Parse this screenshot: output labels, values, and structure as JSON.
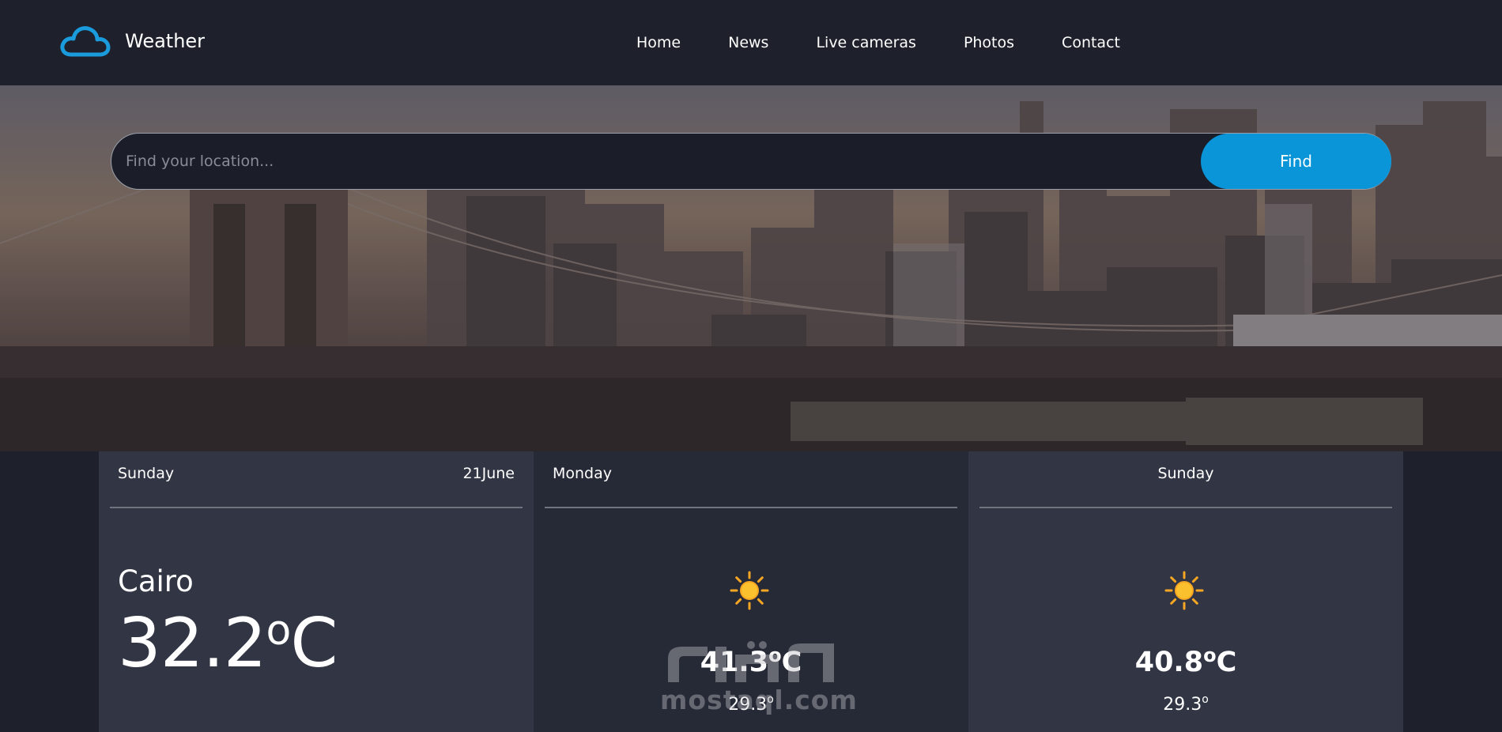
{
  "brand": {
    "name": "Weather",
    "icon": "cloud-icon",
    "accent_color": "#1a9bdc"
  },
  "nav": {
    "items": [
      "Home",
      "News",
      "Live cameras",
      "Photos",
      "Contact"
    ]
  },
  "search": {
    "value": "",
    "placeholder": "Find your location...",
    "button_label": "Find",
    "button_color": "#0a95d8"
  },
  "forecast": [
    {
      "day": "Sunday",
      "date": "21June",
      "city": "Cairo",
      "temp": "32.2",
      "unit_sup": "o",
      "unit": "C"
    },
    {
      "day": "Monday",
      "icon": "sun-icon",
      "max_temp": "41.3",
      "max_unit_sup": "o",
      "max_unit": "C",
      "min_temp": "29.3",
      "min_unit_sup": "o"
    },
    {
      "day": "Sunday",
      "icon": "sun-icon",
      "max_temp": "40.8",
      "max_unit_sup": "o",
      "max_unit": "C",
      "min_temp": "29.3",
      "min_unit_sup": "o"
    }
  ],
  "watermark": {
    "latin": "mostaql.com"
  }
}
